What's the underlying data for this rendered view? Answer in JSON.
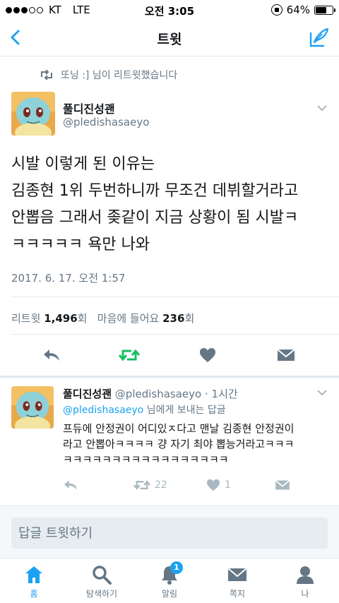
{
  "status_bar": {
    "carrier": "KT",
    "network": "LTE",
    "time": "오전 3:05",
    "battery": "64%",
    "battery_level": 0.64
  },
  "nav": {
    "title": "트윗"
  },
  "retweet_context": "또닝 :] 님이 리트윗했습니다",
  "tweet": {
    "name": "풀디진성괜",
    "handle": "@pledishasaeyo",
    "text_lines": [
      "시발 이렇게 된 이유는",
      "김종현 1위 두번하니까 무조건 데뷔할거라고",
      "안뽑음 그래서 좆같이 지금 상황이 됨 시발ㅋ",
      "ㅋㅋㅋㅋㅋ 욕만 나와"
    ],
    "timestamp": "2017. 6. 17. 오전 1:57",
    "stats": {
      "retweet_label": "리트윗",
      "retweet_count": "1,496",
      "retweet_unit": "회",
      "like_label": "마음에 들어요",
      "like_count": "236",
      "like_unit": "회"
    }
  },
  "reply": {
    "name": "풀디진성괜",
    "handle": "@pledishasaeyo",
    "time": "· 1시간",
    "reply_to_handle": "@pledishasaeyo",
    "reply_to_suffix": " 님에게 보내는 답글",
    "text_lines": [
      "프듀에 안정권이 어디있ㅈ다고 맨날 김종현 안정권이",
      "라고 안뽑아ㅋㅋㅋㅋ 걍 자기 최야 뽑능거라고ㅋㅋㅋ",
      "ㅋㅋㅋㅋㅋㅋㅋㅋㅋㅋㅋㅋㅋㅋㅋㅋㅋ"
    ],
    "retweet_count": "22",
    "like_count": "1"
  },
  "reply_input": {
    "placeholder": "답글 트윗하기"
  },
  "tabs": [
    {
      "label": "홈",
      "icon": "home-icon",
      "active": true
    },
    {
      "label": "탐색하기",
      "icon": "search-icon"
    },
    {
      "label": "알림",
      "icon": "bell-icon",
      "badge": "1"
    },
    {
      "label": "쪽지",
      "icon": "mail-icon"
    },
    {
      "label": "나",
      "icon": "profile-icon"
    }
  ],
  "colors": {
    "accent": "#1da1f2",
    "retweet_green": "#17bf63",
    "muted": "#657786",
    "icon_gray": "#aab8c2"
  }
}
